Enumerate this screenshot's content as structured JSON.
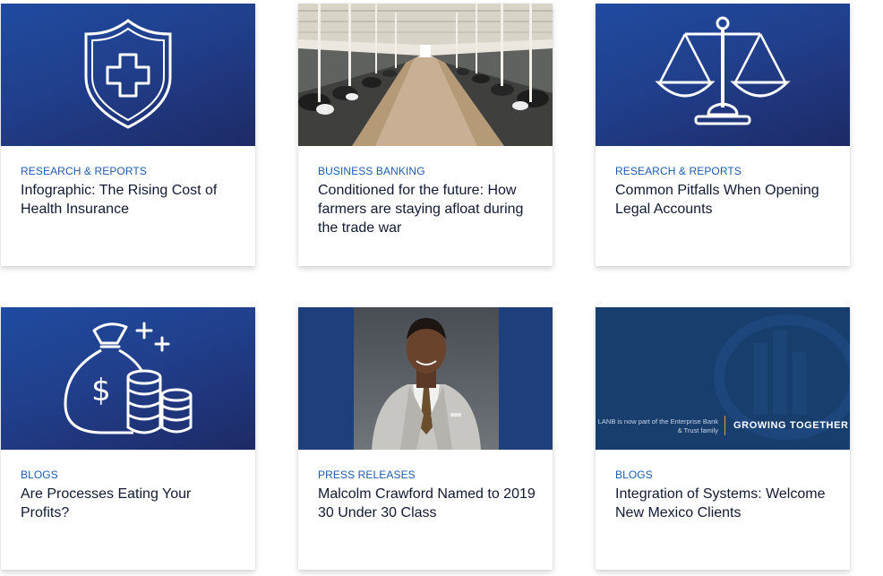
{
  "cards": [
    {
      "category": "RESEARCH & REPORTS",
      "title": "Infographic: The Rising Cost of Health Insurance",
      "image": "shield-plus-icon"
    },
    {
      "category": "BUSINESS BANKING",
      "title": "Conditioned for the future: How farmers are staying afloat during the trade war",
      "image": "dairy-barn-photo"
    },
    {
      "category": "RESEARCH & REPORTS",
      "title": "Common Pitfalls When Opening Legal Accounts",
      "image": "scales-of-justice-icon"
    },
    {
      "category": "BLOGS",
      "title": "Are Processes Eating Your Profits?",
      "image": "money-bag-coins-icon"
    },
    {
      "category": "PRESS RELEASES",
      "title": "Malcolm Crawford Named to 2019 30 Under 30 Class",
      "image": "headshot-photo"
    },
    {
      "category": "BLOGS",
      "title": "Integration of Systems: Welcome New Mexico Clients",
      "image": "lanb-growing-together-banner"
    }
  ],
  "banner": {
    "small_text": "LANB is now part of the Enterprise Bank & Trust family",
    "big_text": "GROWING TOGETHER"
  },
  "colors": {
    "navy": "#213f8c",
    "category_blue": "#1d5bb0",
    "title": "#111a33"
  }
}
